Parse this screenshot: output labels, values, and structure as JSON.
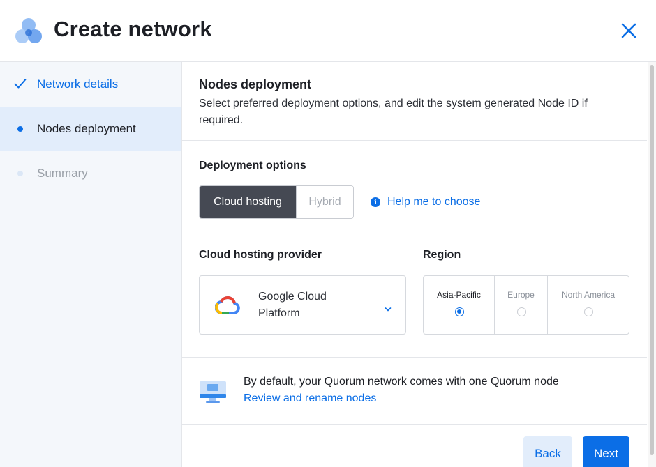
{
  "header": {
    "title": "Create network",
    "logo_icon": "network-logo-icon",
    "close_icon": "close-icon"
  },
  "sidebar": {
    "steps": [
      {
        "label": "Network details",
        "state": "done"
      },
      {
        "label": "Nodes deployment",
        "state": "active"
      },
      {
        "label": "Summary",
        "state": "todo"
      }
    ]
  },
  "main": {
    "section_title": "Nodes deployment",
    "section_desc": "Select preferred deployment options, and edit the system generated Node ID if required.",
    "deployment": {
      "label": "Deployment options",
      "options": [
        "Cloud hosting",
        "Hybrid"
      ],
      "selected": "Cloud hosting",
      "help_link": "Help me to choose"
    },
    "provider": {
      "label": "Cloud hosting provider",
      "selected": "Google Cloud Platform",
      "icon": "google-cloud-icon"
    },
    "region": {
      "label": "Region",
      "options": [
        "Asia-Pacific",
        "Europe",
        "North America"
      ],
      "selected": "Asia-Pacific"
    },
    "nodes": {
      "text": "By default, your Quorum network comes with one Quorum node",
      "link": "Review and rename nodes",
      "icon": "computer-monitor-icon"
    },
    "buttons": {
      "back": "Back",
      "next": "Next"
    }
  },
  "colors": {
    "accent": "#0b6ee6",
    "selected_segment": "#454953",
    "sidebar_bg": "#f4f7fb",
    "active_step_bg": "#e2edfb"
  }
}
